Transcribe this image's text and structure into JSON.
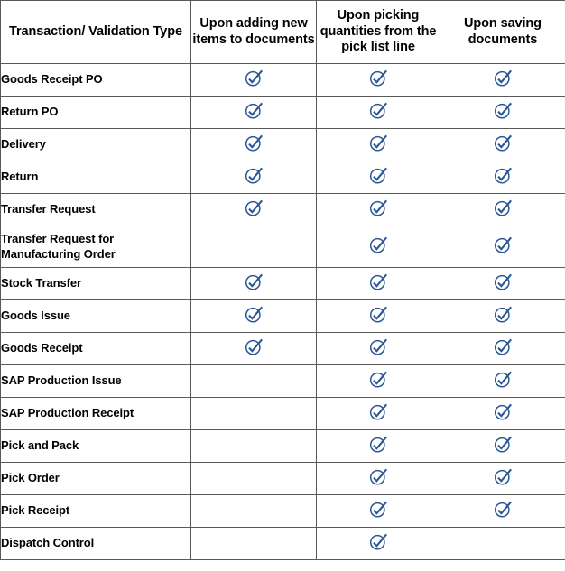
{
  "table": {
    "title_column_header": "Transaction/ Validation Type",
    "column_headers": [
      "Transaction/ Validation Type",
      "Upon adding new items to documents",
      "Upon picking quantities from the pick list line",
      "Upon saving documents"
    ],
    "check_icon_name": "circled-check-icon",
    "check_icon_color": "#2B5797",
    "border_color": "#595959",
    "background_color": "#FFFFFF",
    "text_color": "#000000",
    "rows": [
      {
        "label": "Goods Receipt PO",
        "checks": [
          true,
          true,
          true
        ]
      },
      {
        "label": "Return PO",
        "checks": [
          true,
          true,
          true
        ]
      },
      {
        "label": "Delivery",
        "checks": [
          true,
          true,
          true
        ]
      },
      {
        "label": "Return",
        "checks": [
          true,
          true,
          true
        ]
      },
      {
        "label": "Transfer Request",
        "checks": [
          true,
          true,
          true
        ]
      },
      {
        "label": "Transfer Request for Manufacturing Order",
        "checks": [
          false,
          true,
          true
        ]
      },
      {
        "label": "Stock Transfer",
        "checks": [
          true,
          true,
          true
        ]
      },
      {
        "label": "Goods Issue",
        "checks": [
          true,
          true,
          true
        ]
      },
      {
        "label": "Goods Receipt",
        "checks": [
          true,
          true,
          true
        ]
      },
      {
        "label": "SAP Production Issue",
        "checks": [
          false,
          true,
          true
        ]
      },
      {
        "label": "SAP Production Receipt",
        "checks": [
          false,
          true,
          true
        ]
      },
      {
        "label": "Pick and Pack",
        "checks": [
          false,
          true,
          true
        ]
      },
      {
        "label": "Pick Order",
        "checks": [
          false,
          true,
          true
        ]
      },
      {
        "label": "Pick Receipt",
        "checks": [
          false,
          true,
          true
        ]
      },
      {
        "label": "Dispatch Control",
        "checks": [
          false,
          true,
          false
        ]
      }
    ]
  }
}
